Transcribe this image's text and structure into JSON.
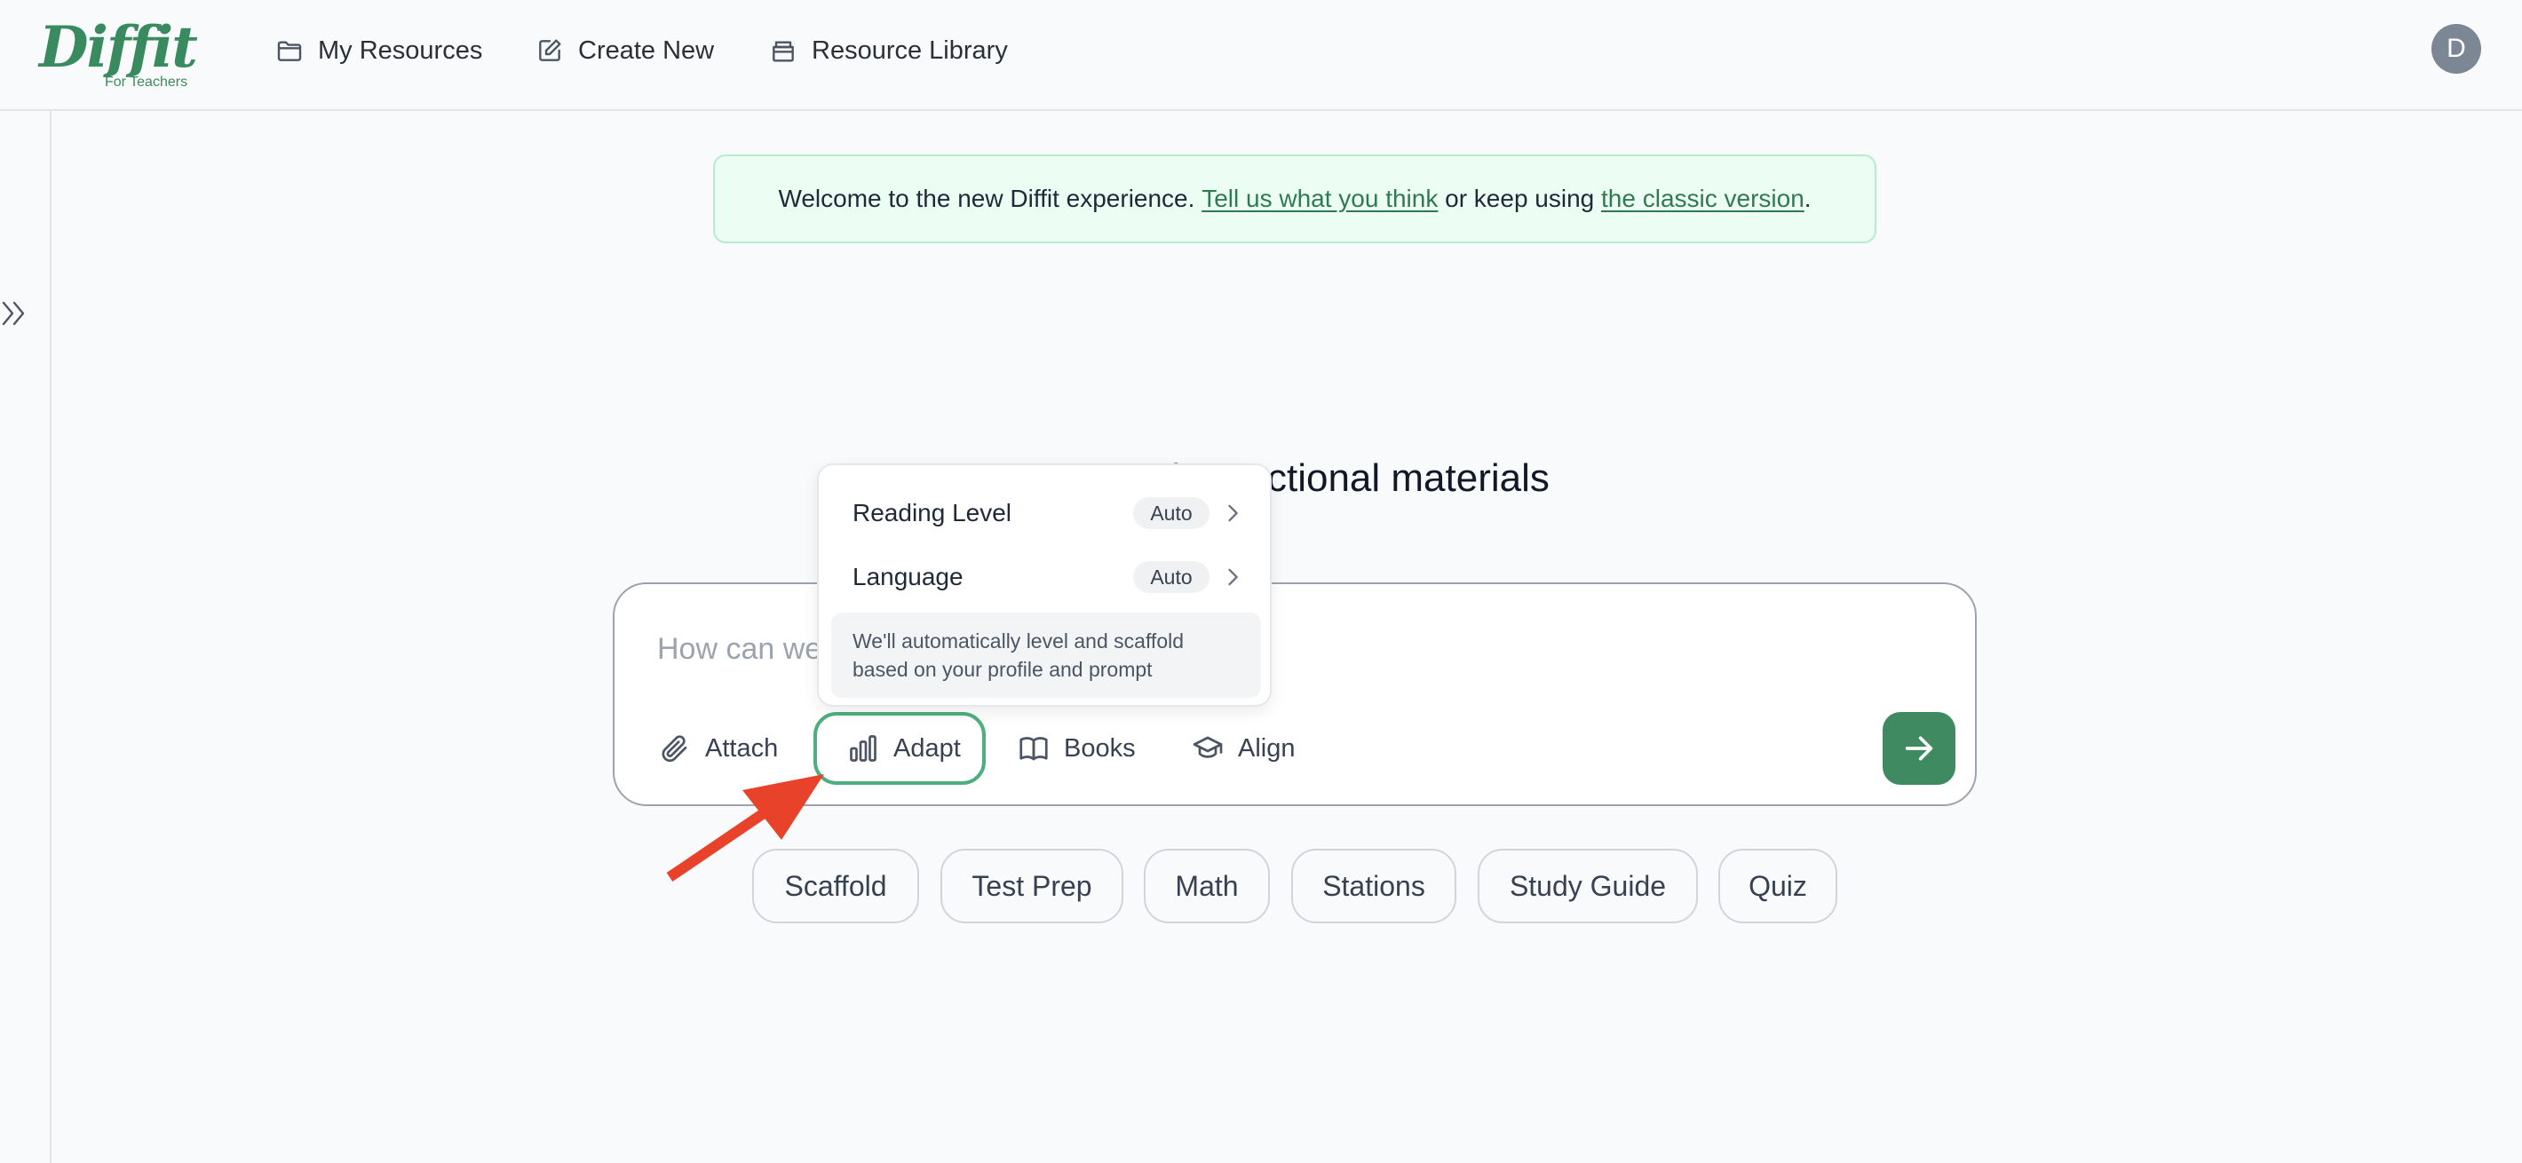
{
  "header": {
    "logo_text": "Diffit",
    "logo_subtext": "For Teachers",
    "nav": [
      {
        "label": "My Resources",
        "icon": "folder-icon"
      },
      {
        "label": "Create New",
        "icon": "edit-icon"
      },
      {
        "label": "Resource Library",
        "icon": "archive-icon"
      }
    ],
    "avatar_initial": "D"
  },
  "sidebar": {
    "toggle_icon": "double-chevron-right-icon"
  },
  "banner": {
    "prefix": "Welcome to the new Diffit experience. ",
    "link1": "Tell us what you think",
    "middle": " or keep using ",
    "link2": "the classic version",
    "suffix": "."
  },
  "headline": "Create instructional materials",
  "composer": {
    "placeholder": "How can we help?",
    "tools": [
      {
        "label": "Attach",
        "icon": "paperclip-icon"
      },
      {
        "label": "Adapt",
        "icon": "bar-chart-icon"
      },
      {
        "label": "Books",
        "icon": "book-icon"
      },
      {
        "label": "Align",
        "icon": "graduation-cap-icon"
      }
    ],
    "send_icon": "arrow-right-icon"
  },
  "adapt_menu": {
    "items": [
      {
        "label": "Reading Level",
        "value": "Auto"
      },
      {
        "label": "Language",
        "value": "Auto"
      }
    ],
    "note": "We'll automatically level and scaffold based on your profile and prompt"
  },
  "chips": [
    "Scaffold",
    "Test Prep",
    "Math",
    "Stations",
    "Study Guide",
    "Quiz"
  ],
  "colors": {
    "brand": "#3a8a5f",
    "send_button": "#3f8a60",
    "adapt_border": "#4caf7d",
    "banner_bg": "#ecfdf3",
    "annotation_arrow": "#e8432a"
  }
}
